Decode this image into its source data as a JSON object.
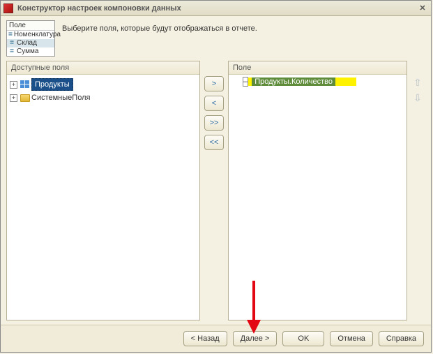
{
  "window": {
    "title": "Конструктор настроек компоновки данных"
  },
  "fieldbox": {
    "header": "Поле",
    "rows": [
      "Номенклатура",
      "Склад",
      "Сумма"
    ],
    "selected_index": 1
  },
  "instruction": "Выберите поля, которые будут отображаться в отчете.",
  "left_panel": {
    "header": "Доступные поля",
    "items": [
      {
        "label": "Продукты",
        "icon": "grid",
        "selected": true
      },
      {
        "label": "СистемныеПоля",
        "icon": "folder",
        "selected": false
      }
    ]
  },
  "right_panel": {
    "header": "Поле",
    "selected_item": "Продукты.Количество"
  },
  "move_buttons": {
    "add": ">",
    "remove": "<",
    "add_all": ">>",
    "remove_all": "<<"
  },
  "order_buttons": {
    "up": "⇧",
    "down": "⇩"
  },
  "footer": {
    "back": "< Назад",
    "next": "Далее >",
    "ok": "OK",
    "cancel": "Отмена",
    "help": "Справка"
  }
}
